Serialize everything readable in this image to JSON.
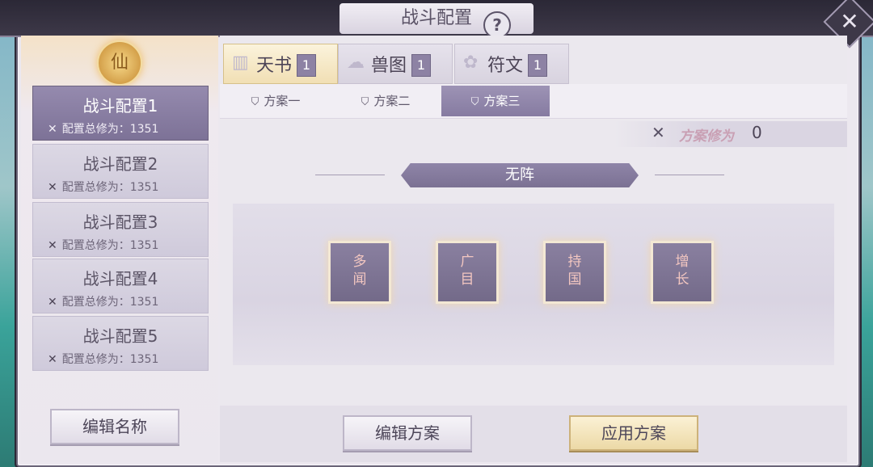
{
  "window": {
    "title": "战斗配置",
    "help_icon": "question-icon",
    "close_icon": "close-icon"
  },
  "sidebar": {
    "emblem": "仙",
    "configs": [
      {
        "name": "战斗配置1",
        "power_label": "配置总修为：",
        "power": "1351",
        "active": true
      },
      {
        "name": "战斗配置2",
        "power_label": "配置总修为：",
        "power": "1351",
        "active": false
      },
      {
        "name": "战斗配置3",
        "power_label": "配置总修为：",
        "power": "1351",
        "active": false
      },
      {
        "name": "战斗配置4",
        "power_label": "配置总修为：",
        "power": "1351",
        "active": false
      },
      {
        "name": "战斗配置5",
        "power_label": "配置总修为：",
        "power": "1351",
        "active": false
      }
    ],
    "rename_button": "编辑名称"
  },
  "tabs": [
    {
      "label": "天书",
      "count": "1",
      "active": true
    },
    {
      "label": "兽图",
      "count": "1",
      "active": false
    },
    {
      "label": "符文",
      "count": "1",
      "active": false
    }
  ],
  "subtabs": [
    {
      "label": "方案一",
      "active": false
    },
    {
      "label": "方案二",
      "active": false
    },
    {
      "label": "方案三",
      "active": true
    }
  ],
  "plan_power": {
    "label": "方案修为",
    "value": "0"
  },
  "formation": {
    "name": "无阵"
  },
  "slots": [
    {
      "label": "多闻"
    },
    {
      "label": "广目"
    },
    {
      "label": "持国"
    },
    {
      "label": "增长"
    }
  ],
  "actions": {
    "edit_plan": "编辑方案",
    "apply_plan": "应用方案"
  },
  "colors": {
    "accent": "#8d82a4",
    "gold": "#ecd9a6",
    "panel": "#ece8ef"
  }
}
